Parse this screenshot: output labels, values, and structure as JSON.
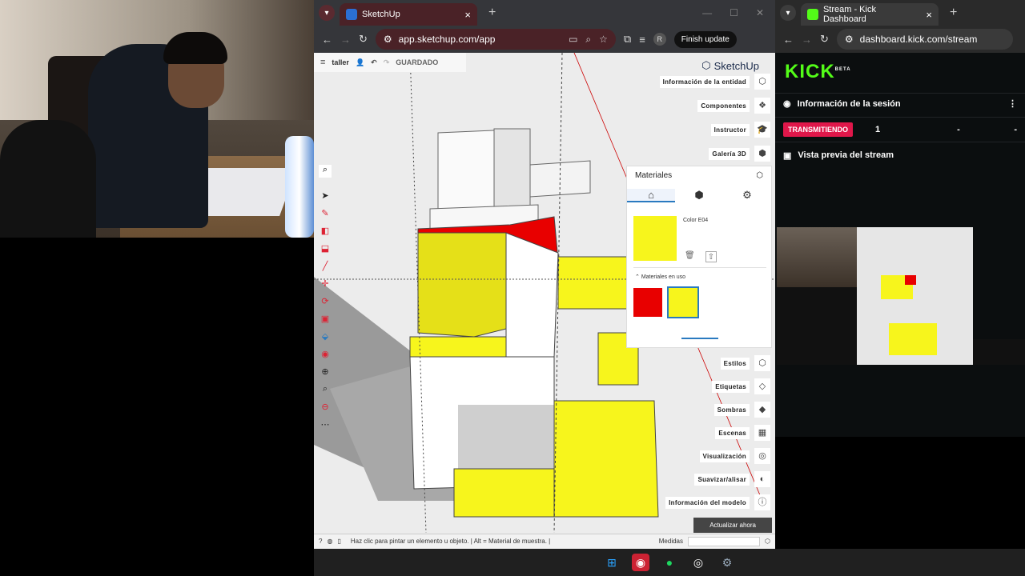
{
  "browser_left": {
    "tab_title": "SketchUp",
    "url": "app.sketchup.com/app",
    "finish_update": "Finish update",
    "profile_initial": "R"
  },
  "browser_right": {
    "tab_title": "Stream - Kick Dashboard",
    "url": "dashboard.kick.com/stream"
  },
  "sketchup": {
    "project_name": "taller",
    "save_status": "GUARDADO",
    "logo_text": "SketchUp",
    "right_panel_top": [
      "Información de la entidad",
      "Componentes",
      "Instructor",
      "Galería 3D"
    ],
    "right_panel_bottom": [
      "Estilos",
      "Etiquetas",
      "Sombras",
      "Escenas",
      "Visualización",
      "Suavizar/alisar",
      "Información del modelo"
    ],
    "materials": {
      "title": "Materiales",
      "color_name": "Color E04",
      "in_use_label": "Materiales en uso",
      "swatches": [
        "#e80000",
        "#f7f51c"
      ],
      "current_color": "#f7f51c"
    },
    "update_button": "Actualizar ahora",
    "status_hint": "Haz clic para pintar un elemento u objeto. | Alt = Material de muestra. |",
    "measures_label": "Medidas"
  },
  "kick": {
    "logo": "KICK",
    "logo_badge": "BETA",
    "session_info": "Información de la sesión",
    "status_pill": "TRANSMITIENDO",
    "viewer_count": "1",
    "dash1": "-",
    "dash2": "-",
    "preview_label": "Vista previa del stream"
  },
  "colors": {
    "chrome_bg": "#35363a",
    "tab_active": "#4a2227",
    "kick_green": "#53fc18",
    "live_red": "#e0174a",
    "model_yellow": "#f7f51c",
    "model_red": "#e80000"
  }
}
